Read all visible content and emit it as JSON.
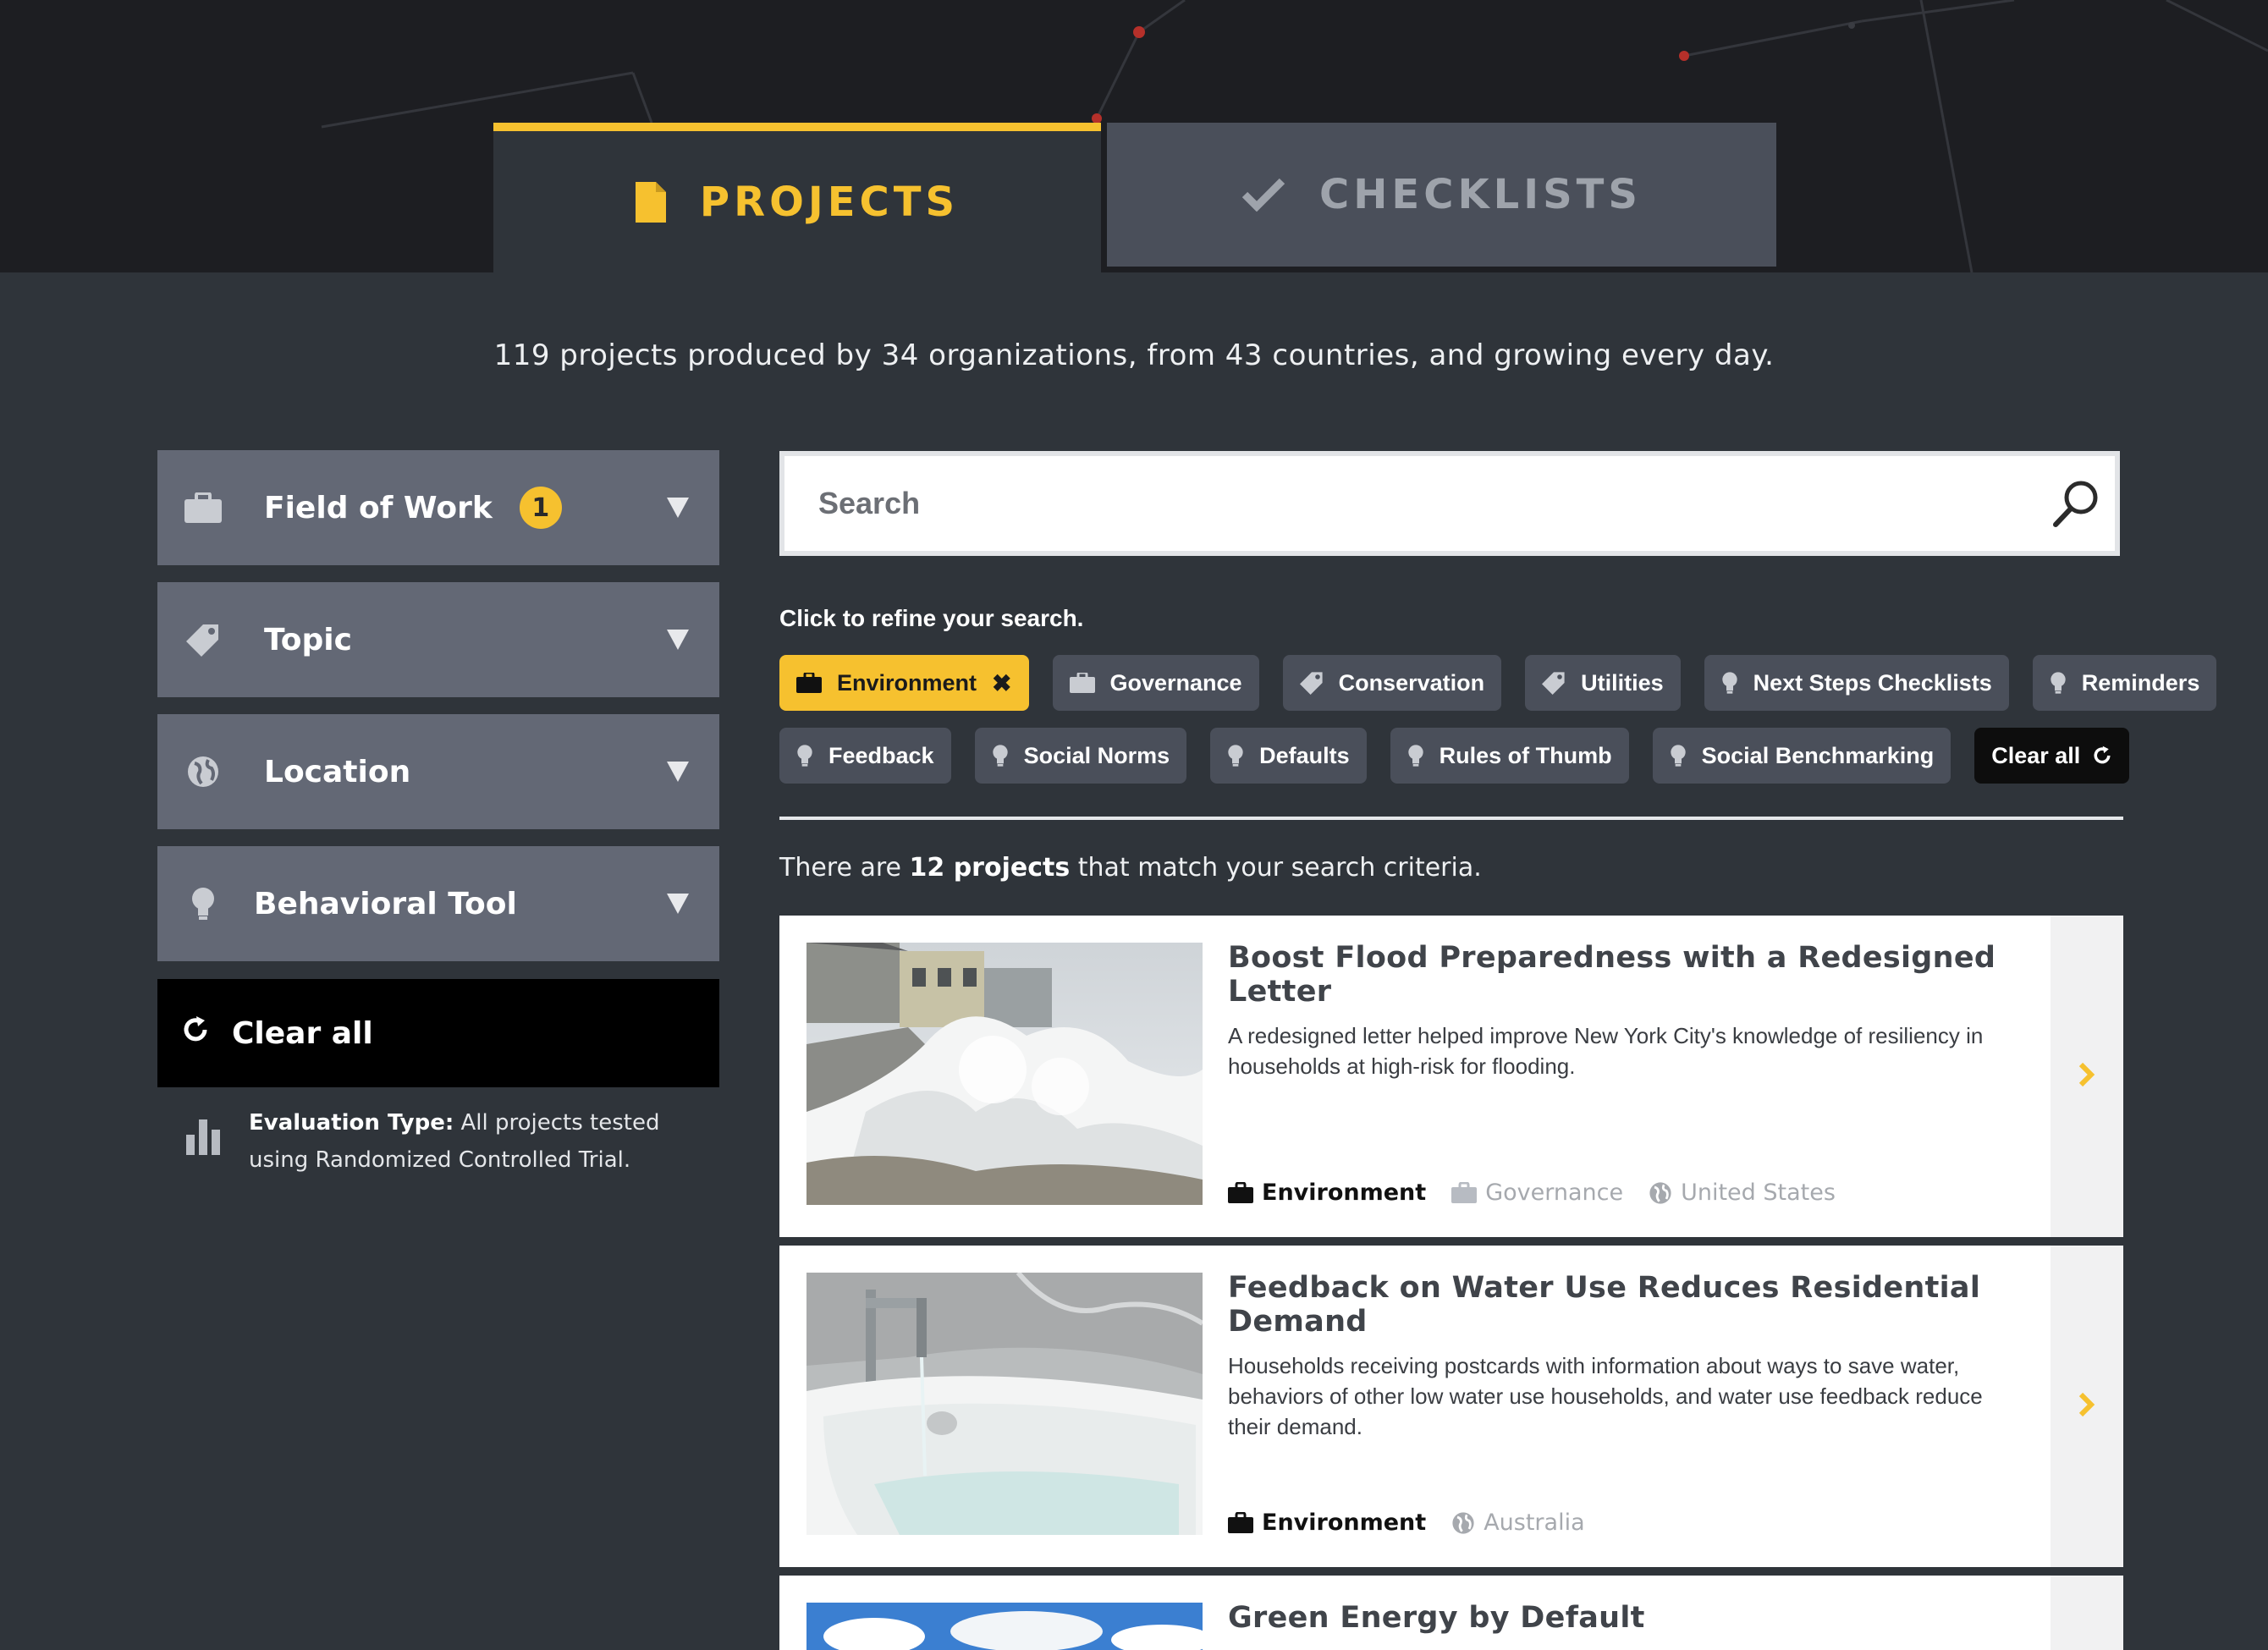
{
  "tabs": [
    {
      "label": "PROJECTS",
      "icon": "document-icon",
      "active": true
    },
    {
      "label": "CHECKLISTS",
      "icon": "checkmark-icon",
      "active": false
    }
  ],
  "intro": "119 projects produced by 34 organizations, from 43 countries, and growing every day.",
  "sidebar": {
    "filters": [
      {
        "label": "Field of Work",
        "icon": "briefcase-icon",
        "badge": "1"
      },
      {
        "label": "Topic",
        "icon": "tag-icon"
      },
      {
        "label": "Location",
        "icon": "globe-icon"
      },
      {
        "label": "Behavioral Tool",
        "icon": "lightbulb-icon"
      }
    ],
    "clear_all": "Clear all",
    "evaluation_label": "Evaluation Type:",
    "evaluation_text": " All projects tested using Randomized Controlled Trial."
  },
  "search": {
    "placeholder": "Search"
  },
  "refine_label": "Click to refine your search.",
  "chips": {
    "row1": [
      "Environment",
      "Governance",
      "Conservation",
      "Utilities",
      "Next Steps Checklists",
      "Reminders"
    ],
    "row2": [
      "Feedback",
      "Social Norms",
      "Defaults",
      "Rules of Thumb",
      "Social Benchmarking"
    ],
    "clear_all": "Clear all"
  },
  "results": {
    "prefix": "There are ",
    "count": "12 projects",
    "suffix": " that match your search criteria."
  },
  "projects": [
    {
      "title": "Boost Flood Preparedness with a Redesigned Letter",
      "description": "A redesigned letter helped improve New York City's knowledge of resiliency in households at high-risk for flooding.",
      "tags": [
        "Environment",
        "Governance",
        "United States"
      ]
    },
    {
      "title": "Feedback on Water Use Reduces Residential Demand",
      "description": "Households receiving postcards with information about ways to save water, behaviors of other low water use households, and water use feedback reduce their demand.",
      "tags": [
        "Environment",
        "Australia"
      ]
    },
    {
      "title": "Green Energy by Default",
      "description": "",
      "tags": []
    }
  ],
  "colors": {
    "accent": "#f6c12f",
    "header_bg": "#1d1e22",
    "page_bg": "#2f343a",
    "panel": "#636875",
    "chip": "#4a4f5a"
  }
}
